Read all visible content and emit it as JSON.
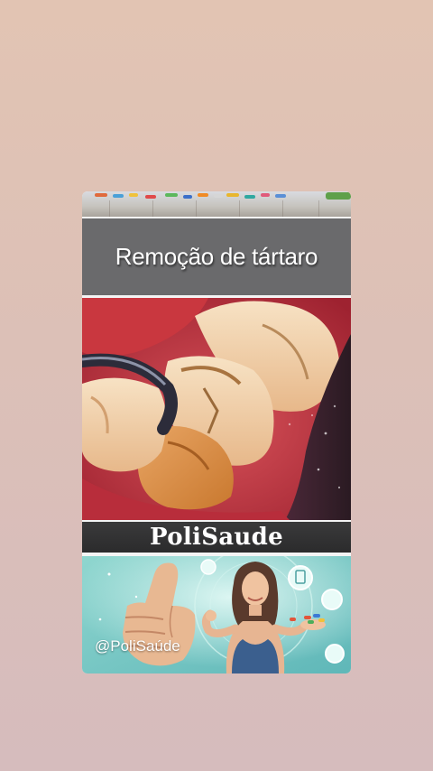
{
  "post": {
    "title": "Remoção de tártaro",
    "brand": "PoliSaude",
    "handle": "@PoliSaúde"
  },
  "icons": {
    "photo": "tartar-removal-teeth-photo",
    "promo": "woman-thumbs-up-illustration"
  },
  "colors": {
    "title_bar": "#6a6a6c",
    "brand_bar": "#2b2b2c",
    "background_top": "#e2c4b3",
    "background_bottom": "#d6bcbd"
  }
}
